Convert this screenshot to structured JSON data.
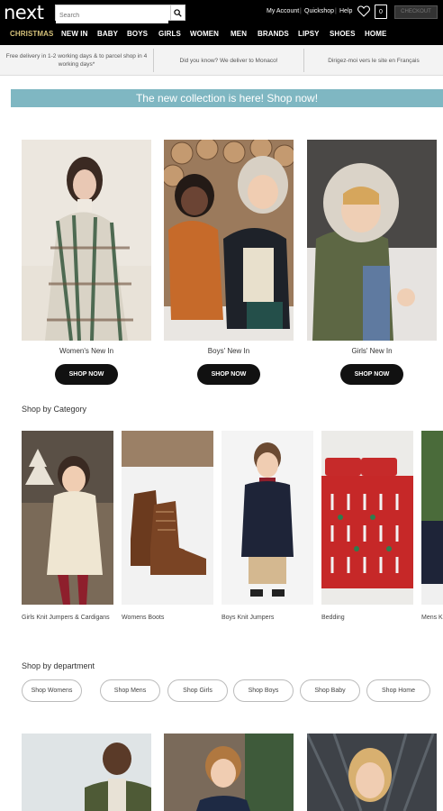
{
  "header": {
    "logo": "next",
    "search_placeholder": "Search",
    "links": [
      "My Account",
      "Quickshop",
      "Help"
    ],
    "bag_count": "0",
    "checkout_label": "CHECKOUT"
  },
  "nav": {
    "items": [
      "CHRISTMAS",
      "NEW IN",
      "BABY",
      "BOYS",
      "GIRLS",
      "WOMEN",
      "MEN",
      "BRANDS",
      "LIPSY",
      "SHOES",
      "HOME"
    ],
    "active": "CHRISTMAS"
  },
  "info_bar": {
    "items": [
      "Free delivery in 1-2 working days & to parcel shop in 4 working days*",
      "Did you know? We deliver to Monaco!",
      "Dirigez-moi vers le site en Français"
    ]
  },
  "promo_banner": "The new collection is here! Shop now!",
  "new_in": {
    "tiles": [
      {
        "label": "Women's New In",
        "button": "SHOP NOW"
      },
      {
        "label": "Boys' New In",
        "button": "SHOP NOW"
      },
      {
        "label": "Girls' New In",
        "button": "SHOP NOW"
      }
    ]
  },
  "shop_by_category": {
    "heading": "Shop by Category",
    "items": [
      "Girls Knit Jumpers & Cardigans",
      "Womens Boots",
      "Boys Knit Jumpers",
      "Bedding",
      "Mens K"
    ]
  },
  "shop_by_department": {
    "heading": "Shop by department",
    "pills": [
      "Shop Womens",
      "Shop Mens",
      "Shop Girls",
      "Shop Boys",
      "Shop Baby",
      "Shop Home"
    ]
  },
  "colors": {
    "header_bg": "#000000",
    "nav_active": "#d6c27a",
    "promo_bg": "#7fb7c2",
    "button_bg": "#111111"
  }
}
